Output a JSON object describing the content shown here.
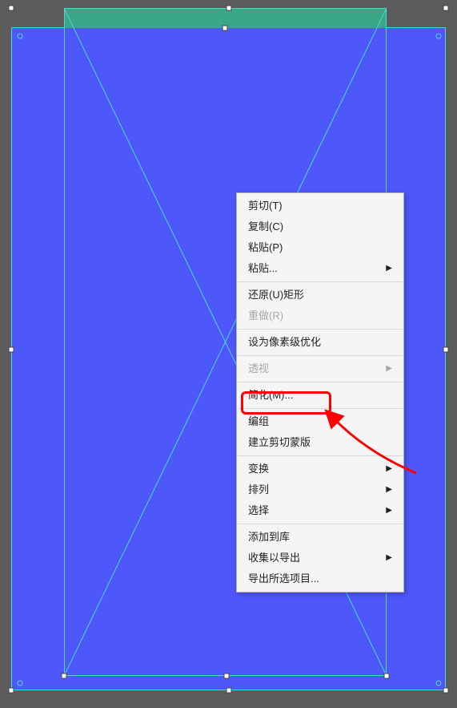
{
  "menu": {
    "items": [
      {
        "label": "剪切(T)",
        "disabled": false,
        "submenu": false
      },
      {
        "label": "复制(C)",
        "disabled": false,
        "submenu": false
      },
      {
        "label": "粘贴(P)",
        "disabled": false,
        "submenu": false
      },
      {
        "label": "粘贴...",
        "disabled": false,
        "submenu": true
      },
      {
        "sep": true
      },
      {
        "label": "还原(U)矩形",
        "disabled": false,
        "submenu": false
      },
      {
        "label": "重做(R)",
        "disabled": true,
        "submenu": false
      },
      {
        "sep": true
      },
      {
        "label": "设为像素级优化",
        "disabled": false,
        "submenu": false
      },
      {
        "sep": true
      },
      {
        "label": "透视",
        "disabled": true,
        "submenu": true
      },
      {
        "sep": true
      },
      {
        "label": "简化(M)...",
        "disabled": false,
        "submenu": false
      },
      {
        "sep": true
      },
      {
        "label": "编组",
        "disabled": false,
        "submenu": false
      },
      {
        "label": "建立剪切蒙版",
        "disabled": false,
        "submenu": false
      },
      {
        "sep": true
      },
      {
        "label": "变换",
        "disabled": false,
        "submenu": true
      },
      {
        "label": "排列",
        "disabled": false,
        "submenu": true
      },
      {
        "label": "选择",
        "disabled": false,
        "submenu": true
      },
      {
        "sep": true
      },
      {
        "label": "添加到库",
        "disabled": false,
        "submenu": false
      },
      {
        "label": "收集以导出",
        "disabled": false,
        "submenu": true
      },
      {
        "label": "导出所选项目...",
        "disabled": false,
        "submenu": false
      }
    ]
  },
  "highlighted_item": "建立剪切蒙版",
  "colors": {
    "canvas_bg": "#5c5c5c",
    "shape_fill": "#4e57fa",
    "selection_stroke": "#4ad9cf",
    "green_overlay": "#3aa887",
    "annotation_red": "#ff0000"
  }
}
